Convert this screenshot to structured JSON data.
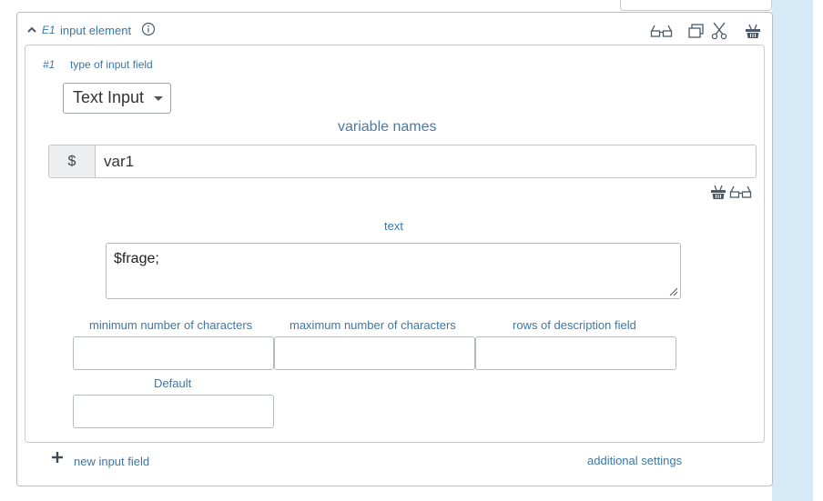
{
  "header": {
    "collapse_icon": "chevron-up-icon",
    "element_id": "E1",
    "title": "input element",
    "info_icon": "info-icon",
    "toolbar_icons": [
      "glasses-icon",
      "copy-icon",
      "scissors-icon",
      "basket-icon"
    ]
  },
  "field": {
    "number": "#1",
    "type_label": "type of input field",
    "type_selected": "Text Input"
  },
  "variables": {
    "label": "variable names",
    "prefix": "$",
    "value": "var1",
    "tool_icons": [
      "basket-icon",
      "glasses-icon"
    ]
  },
  "text": {
    "label": "text",
    "value": "$frage;"
  },
  "options": {
    "min_chars_label": "minimum number of characters",
    "max_chars_label": "maximum number of characters",
    "rows_label": "rows of description field",
    "default_label": "Default",
    "min_chars_value": "",
    "max_chars_value": "",
    "rows_value": "",
    "default_value": ""
  },
  "footer": {
    "add_icon": "plus-icon",
    "new_field_label": "new input field",
    "additional_settings_label": "additional settings"
  },
  "colors": {
    "link_blue": "#3a78a8",
    "border": "#b9bdc1",
    "side_panel": "#d6e9f6"
  }
}
